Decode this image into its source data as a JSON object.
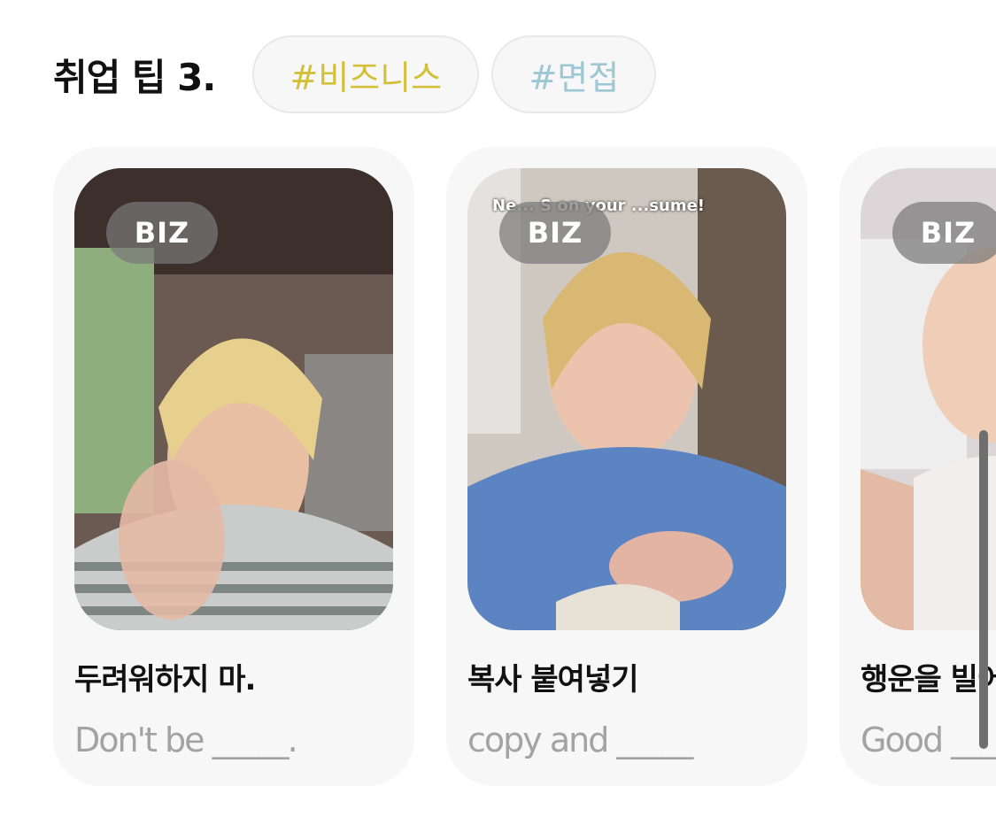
{
  "section": {
    "title": "취업 팁 3.",
    "tags": [
      {
        "label": "#비즈니스",
        "color": "#d2bf3a"
      },
      {
        "label": "#면접",
        "color": "#9cc7d3"
      }
    ]
  },
  "cards": [
    {
      "badge": "BIZ",
      "title_ko": "두려워하지 마.",
      "subtitle_en": "Don't be _____."
    },
    {
      "badge": "BIZ",
      "title_ko": "복사 붙여넣기",
      "subtitle_en": "copy and _____",
      "video_caption": "Ne... S on your ...sume!"
    },
    {
      "badge": "BIZ",
      "title_ko": "행운을 빌어",
      "subtitle_en": "Good ___"
    }
  ],
  "icons": {
    "scroll": "vertical-scrollbar"
  }
}
